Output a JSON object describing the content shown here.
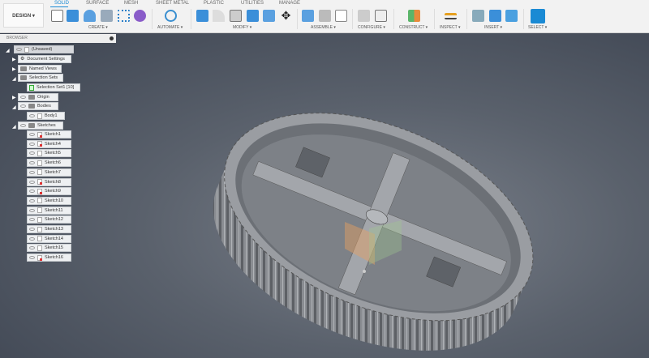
{
  "toolbar": {
    "workspace": "DESIGN ▾",
    "tabs": [
      "SOLID",
      "SURFACE",
      "MESH",
      "SHEET METAL",
      "PLASTIC",
      "UTILITIES",
      "MANAGE"
    ],
    "groups": [
      "CREATE ▾",
      "AUTOMATE ▾",
      "MODIFY ▾",
      "ASSEMBLE ▾",
      "CONFIGURE ▾",
      "CONSTRUCT ▾",
      "INSPECT ▾",
      "INSERT ▾",
      "SELECT ▾"
    ]
  },
  "browser": {
    "title": "BROWSER",
    "root": "(Unsaved)",
    "items": [
      "Document Settings",
      "Named Views",
      "Selection Sets",
      "Selection Set1 [10]",
      "Origin",
      "Bodies",
      "Body1",
      "Sketches"
    ],
    "sketches": [
      "Sketch1",
      "Sketch4",
      "Sketch5",
      "Sketch6",
      "Sketch7",
      "Sketch8",
      "Sketch9",
      "Sketch10",
      "Sketch11",
      "Sketch12",
      "Sketch13",
      "Sketch14",
      "Sketch15",
      "Sketch16"
    ]
  },
  "colors": {
    "accent": "#1a8ad4",
    "toolbar": "#f2f2f2"
  }
}
